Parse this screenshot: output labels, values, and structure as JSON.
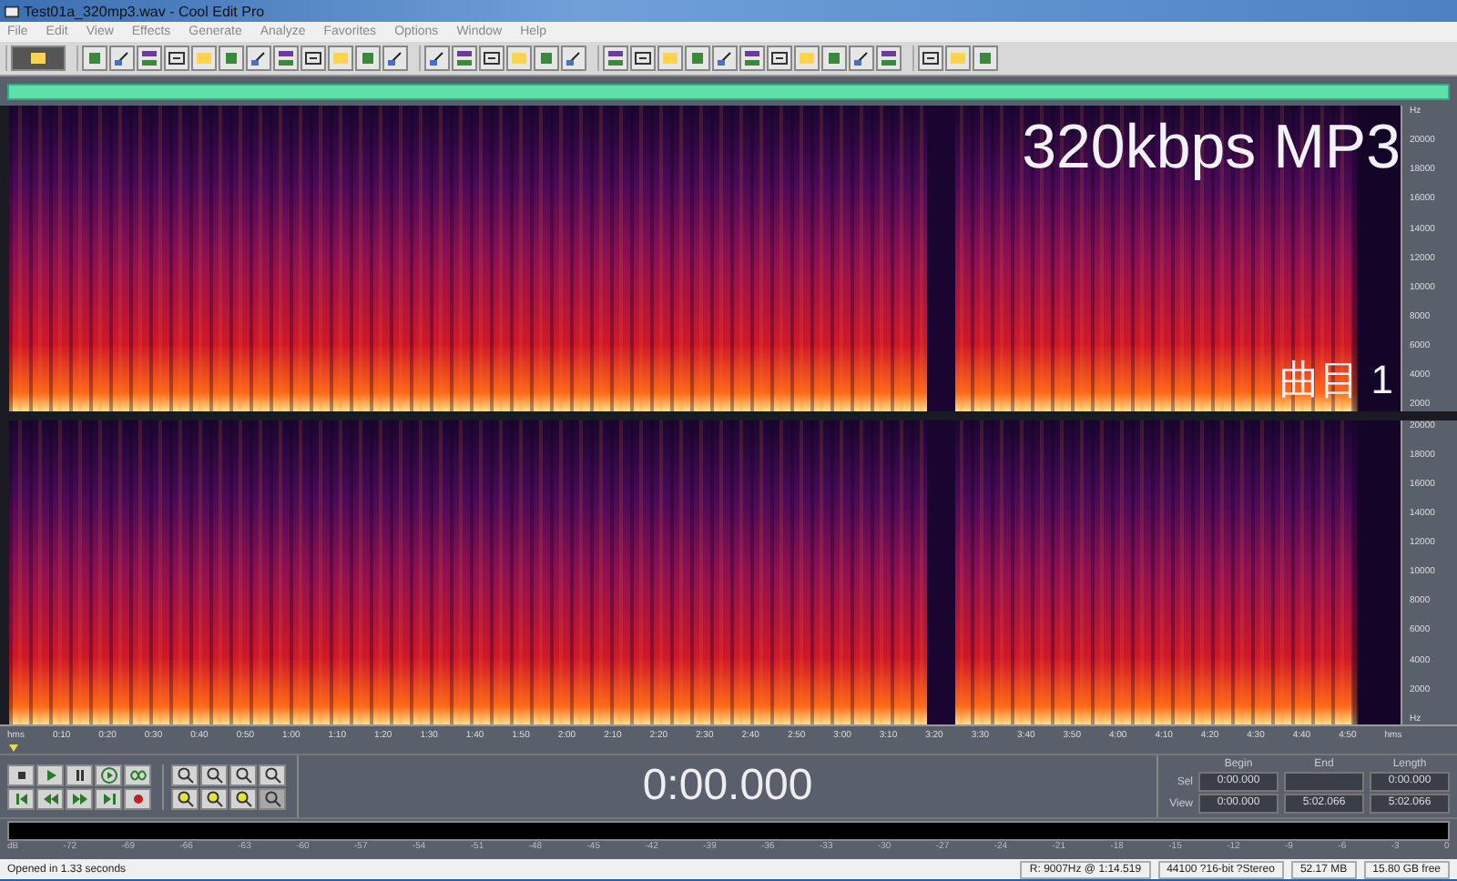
{
  "window": {
    "title": "Test01a_320mp3.wav - Cool Edit Pro"
  },
  "menu": [
    "File",
    "Edit",
    "View",
    "Effects",
    "Generate",
    "Analyze",
    "Favorites",
    "Options",
    "Window",
    "Help"
  ],
  "channels": [
    {
      "overlay_title": "320kbps MP3",
      "overlay_track": "曲目 1",
      "hz_ticks": [
        "Hz",
        "20000",
        "18000",
        "16000",
        "14000",
        "12000",
        "10000",
        "8000",
        "6000",
        "4000",
        "2000"
      ]
    },
    {
      "hz_ticks": [
        "20000",
        "18000",
        "16000",
        "14000",
        "12000",
        "10000",
        "8000",
        "6000",
        "4000",
        "2000",
        "Hz"
      ]
    }
  ],
  "time_ruler": [
    "hms",
    "0:10",
    "0:20",
    "0:30",
    "0:40",
    "0:50",
    "1:00",
    "1:10",
    "1:20",
    "1:30",
    "1:40",
    "1:50",
    "2:00",
    "2:10",
    "2:20",
    "2:30",
    "2:40",
    "2:50",
    "3:00",
    "3:10",
    "3:20",
    "3:30",
    "3:40",
    "3:50",
    "4:00",
    "4:10",
    "4:20",
    "4:30",
    "4:40",
    "4:50",
    "hms"
  ],
  "time_display": "0:00.000",
  "selection": {
    "columns": [
      "Begin",
      "End",
      "Length"
    ],
    "rows": [
      {
        "label": "Sel",
        "cells": [
          "0:00.000",
          null,
          "0:00.000"
        ]
      },
      {
        "label": "View",
        "cells": [
          "0:00.000",
          "5:02.066",
          "5:02.066"
        ]
      }
    ]
  },
  "meter_ticks": [
    "dB",
    "-72",
    "-69",
    "-66",
    "-63",
    "-60",
    "-57",
    "-54",
    "-51",
    "-48",
    "-45",
    "-42",
    "-39",
    "-36",
    "-33",
    "-30",
    "-27",
    "-24",
    "-21",
    "-18",
    "-15",
    "-12",
    "-9",
    "-6",
    "-3",
    "0"
  ],
  "status_bar": {
    "message": "Opened in 1.33 seconds",
    "cells": [
      "R: 9007Hz @  1:14.519",
      "44100 ?16-bit ?Stereo",
      "52.17 MB",
      "15.80 GB free"
    ]
  }
}
